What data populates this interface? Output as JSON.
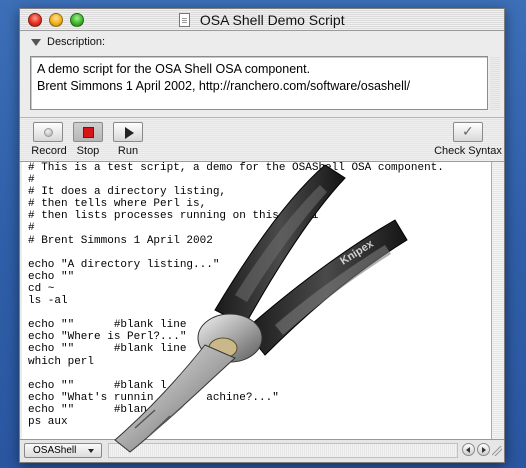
{
  "window": {
    "title": "OSA Shell Demo Script"
  },
  "description": {
    "label": "Description:",
    "lines": [
      "A demo script for the OSA Shell OSA component.",
      "Brent Simmons 1 April 2002, http://ranchero.com/software/osashell/"
    ]
  },
  "toolbar": {
    "record_label": "Record",
    "stop_label": "Stop",
    "run_label": "Run",
    "check_syntax_label": "Check Syntax"
  },
  "script": {
    "lines": [
      "# This is a test script, a demo for the OSAShell OSA component.",
      "#",
      "# It does a directory listing,",
      "# then tells where Perl is,",
      "# then lists processes running on this machi",
      "#",
      "# Brent Simmons 1 April 2002",
      "",
      "echo \"A directory listing...\"",
      "echo \"\"",
      "cd ~",
      "ls -al",
      "",
      "echo \"\"      #blank line",
      "echo \"Where is Perl?...\"",
      "echo \"\"      #blank line",
      "which perl",
      "",
      "echo \"\"      #blank l",
      "echo \"What's runnin        achine?...\"",
      "echo \"\"      #blan",
      "ps aux"
    ]
  },
  "status": {
    "language_popup": "OSAShell"
  },
  "overlay": {
    "image": "pliers",
    "handle_text": "Knipex"
  }
}
